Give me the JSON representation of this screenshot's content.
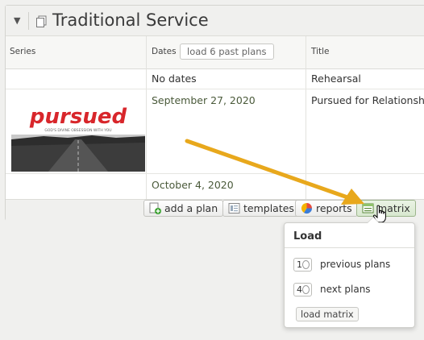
{
  "service": {
    "title": "Traditional Service"
  },
  "columns": {
    "series": "Series",
    "dates": "Dates",
    "load_past": "load 6 past plans",
    "title": "Title"
  },
  "rows": [
    {
      "date": "No dates",
      "title": "Rehearsal"
    },
    {
      "date": "September 27, 2020",
      "title": "Pursued for Relationship"
    },
    {
      "date": "October 4, 2020",
      "title": ""
    }
  ],
  "series_art": {
    "title": "pursued",
    "tagline": "GOD'S DIVINE OBSESSION WITH YOU"
  },
  "toolbar": {
    "add_plan": "add a plan",
    "templates": "templates",
    "reports": "reports",
    "matrix": "matrix"
  },
  "popover": {
    "title": "Load",
    "previous_count": "1",
    "previous_label": "previous plans",
    "next_count": "4",
    "next_label": "next plans",
    "load_button": "load matrix"
  },
  "colors": {
    "arrow": "#e8a81c",
    "date_text": "#4a5a3a"
  }
}
